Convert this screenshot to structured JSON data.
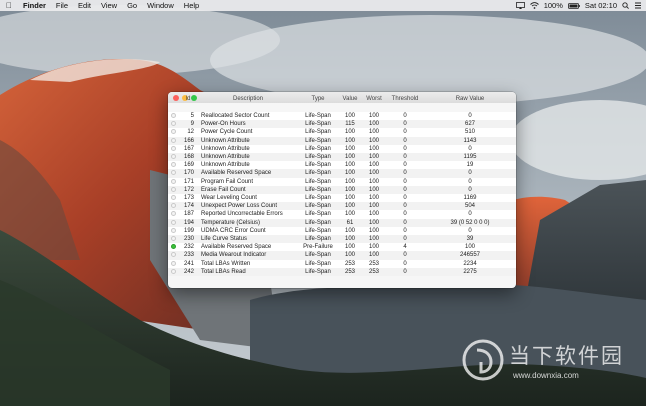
{
  "menubar": {
    "app_name": "Finder",
    "items": [
      "File",
      "Edit",
      "View",
      "Go",
      "Window",
      "Help"
    ],
    "battery": "100%",
    "clock": "Sat 02:10"
  },
  "table": {
    "headers": {
      "id": "Id",
      "description": "Description",
      "type": "Type",
      "value": "Value",
      "worst": "Worst",
      "threshold": "Threshold",
      "raw": "Raw Value"
    },
    "rows": [
      {
        "status": "ok",
        "id": "5",
        "desc": "Reallocated Sector Count",
        "type": "Life-Span",
        "value": "100",
        "worst": "100",
        "thr": "0",
        "raw": "0"
      },
      {
        "status": "ok",
        "id": "9",
        "desc": "Power-On Hours",
        "type": "Life-Span",
        "value": "115",
        "worst": "100",
        "thr": "0",
        "raw": "627"
      },
      {
        "status": "ok",
        "id": "12",
        "desc": "Power Cycle Count",
        "type": "Life-Span",
        "value": "100",
        "worst": "100",
        "thr": "0",
        "raw": "510"
      },
      {
        "status": "ok",
        "id": "166",
        "desc": "Unknown Attribute",
        "type": "Life-Span",
        "value": "100",
        "worst": "100",
        "thr": "0",
        "raw": "1143"
      },
      {
        "status": "ok",
        "id": "167",
        "desc": "Unknown Attribute",
        "type": "Life-Span",
        "value": "100",
        "worst": "100",
        "thr": "0",
        "raw": "0"
      },
      {
        "status": "ok",
        "id": "168",
        "desc": "Unknown Attribute",
        "type": "Life-Span",
        "value": "100",
        "worst": "100",
        "thr": "0",
        "raw": "1195"
      },
      {
        "status": "ok",
        "id": "169",
        "desc": "Unknown Attribute",
        "type": "Life-Span",
        "value": "100",
        "worst": "100",
        "thr": "0",
        "raw": "19"
      },
      {
        "status": "ok",
        "id": "170",
        "desc": "Available Reserved Space",
        "type": "Life-Span",
        "value": "100",
        "worst": "100",
        "thr": "0",
        "raw": "0"
      },
      {
        "status": "ok",
        "id": "171",
        "desc": "Program Fail Count",
        "type": "Life-Span",
        "value": "100",
        "worst": "100",
        "thr": "0",
        "raw": "0"
      },
      {
        "status": "ok",
        "id": "172",
        "desc": "Erase Fail Count",
        "type": "Life-Span",
        "value": "100",
        "worst": "100",
        "thr": "0",
        "raw": "0"
      },
      {
        "status": "ok",
        "id": "173",
        "desc": "Wear Leveling Count",
        "type": "Life-Span",
        "value": "100",
        "worst": "100",
        "thr": "0",
        "raw": "1169"
      },
      {
        "status": "ok",
        "id": "174",
        "desc": "Unexpect Power Loss Count",
        "type": "Life-Span",
        "value": "100",
        "worst": "100",
        "thr": "0",
        "raw": "504"
      },
      {
        "status": "ok",
        "id": "187",
        "desc": "Reported Uncorrectable Errors",
        "type": "Life-Span",
        "value": "100",
        "worst": "100",
        "thr": "0",
        "raw": "0"
      },
      {
        "status": "ok",
        "id": "194",
        "desc": "Temperature (Celsius)",
        "type": "Life-Span",
        "value": "61",
        "worst": "100",
        "thr": "0",
        "raw": "39 (0 52 0 0 0)"
      },
      {
        "status": "ok",
        "id": "199",
        "desc": "UDMA CRC Error Count",
        "type": "Life-Span",
        "value": "100",
        "worst": "100",
        "thr": "0",
        "raw": "0"
      },
      {
        "status": "ok",
        "id": "230",
        "desc": "Life Curve Status",
        "type": "Life-Span",
        "value": "100",
        "worst": "100",
        "thr": "0",
        "raw": "39"
      },
      {
        "status": "good",
        "id": "232",
        "desc": "Available Reserved Space",
        "type": "Pre-Failure",
        "value": "100",
        "worst": "100",
        "thr": "4",
        "raw": "100"
      },
      {
        "status": "ok",
        "id": "233",
        "desc": "Media Wearout Indicator",
        "type": "Life-Span",
        "value": "100",
        "worst": "100",
        "thr": "0",
        "raw": "246557"
      },
      {
        "status": "ok",
        "id": "241",
        "desc": "Total LBAs Written",
        "type": "Life-Span",
        "value": "253",
        "worst": "253",
        "thr": "0",
        "raw": "2234"
      },
      {
        "status": "ok",
        "id": "242",
        "desc": "Total LBAs Read",
        "type": "Life-Span",
        "value": "253",
        "worst": "253",
        "thr": "0",
        "raw": "2275"
      }
    ]
  },
  "watermark": {
    "text": "当下软件园",
    "url": "www.downxia.com"
  },
  "colors": {
    "good_status": "#3cc23c",
    "close": "#fc605c",
    "minimize": "#fdbc40",
    "maximize": "#34c84a"
  }
}
